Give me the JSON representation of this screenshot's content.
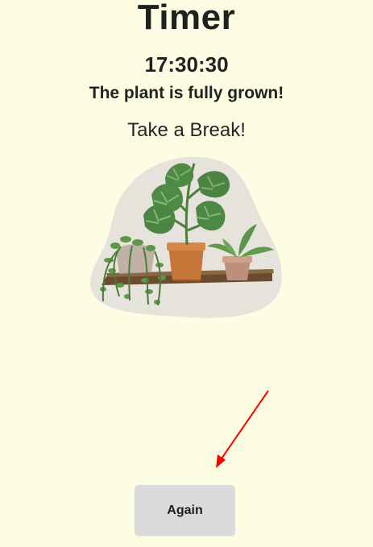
{
  "app": {
    "title": "Timer"
  },
  "timer": {
    "display_time": "17:30:30",
    "status_message": "The plant is fully grown!",
    "break_message": "Take a Break!"
  },
  "actions": {
    "again_label": "Again"
  },
  "illustration": {
    "icon": "potted-plants-illustration"
  },
  "colors": {
    "background": "#fdfde3",
    "button": "#dbdbdb",
    "arrow": "#ff0000"
  }
}
